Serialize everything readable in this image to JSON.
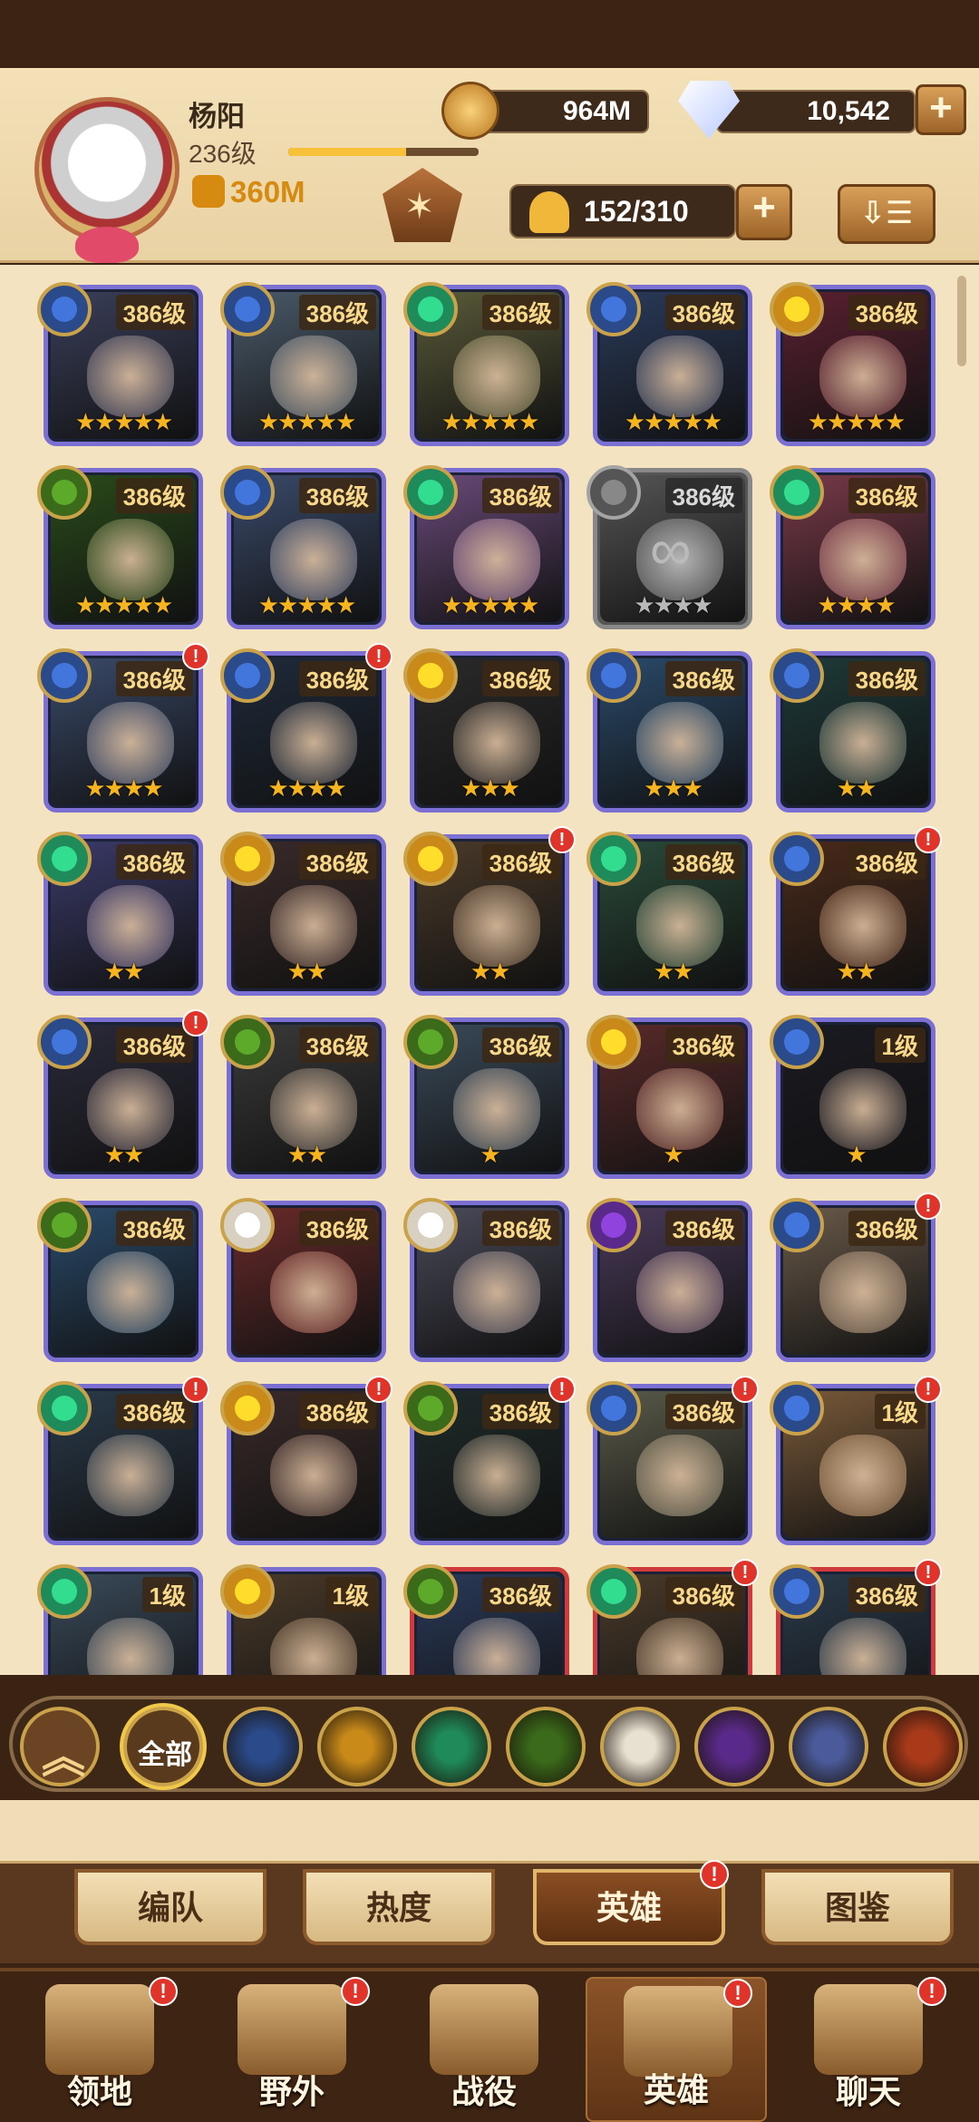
{
  "player": {
    "name": "杨阳",
    "level": "236级",
    "power": "360M",
    "xp_fraction": 0.62
  },
  "resources": {
    "gold": "964M",
    "gems": "10,542"
  },
  "hero_count": "152/310",
  "icons": {
    "gold": "gold-coin-icon",
    "gem": "diamond-icon",
    "plus": "+",
    "sort": "⇩☰",
    "emblem": "✶",
    "up": "︽"
  },
  "colors": {
    "purple_frame": "#7c6fd3",
    "red_frame": "#d13a3a",
    "alert": "#e0342a",
    "star": "#f6b51f"
  },
  "heroes": [
    {
      "level": "386级",
      "stars": "★★★★★",
      "faction": "#2a4a8a",
      "art": "#3a3f5a",
      "alert": false,
      "frame": "purple"
    },
    {
      "level": "386级",
      "stars": "★★★★★",
      "faction": "#2a4a8a",
      "art": "#4a5a6a",
      "alert": false,
      "frame": "purple"
    },
    {
      "level": "386级",
      "stars": "★★★★★",
      "faction": "#1f8a5a",
      "art": "#5a5a3a",
      "alert": false,
      "frame": "purple"
    },
    {
      "level": "386级",
      "stars": "★★★★★",
      "faction": "#2a4a8a",
      "art": "#2a3a5a",
      "alert": false,
      "frame": "purple"
    },
    {
      "level": "386级",
      "stars": "★★★★★",
      "faction": "#c98a1a",
      "art": "#5a2030",
      "alert": false,
      "frame": "purple"
    },
    {
      "level": "386级",
      "stars": "★★★★★",
      "faction": "#3a6a1a",
      "art": "#2a4a1a",
      "alert": false,
      "frame": "purple"
    },
    {
      "level": "386级",
      "stars": "★★★★★",
      "faction": "#2a4a8a",
      "art": "#3a4a6a",
      "alert": false,
      "frame": "purple"
    },
    {
      "level": "386级",
      "stars": "★★★★★",
      "faction": "#1f8a5a",
      "art": "#6a4a7a",
      "alert": false,
      "frame": "purple"
    },
    {
      "level": "386级",
      "stars": "★★★★",
      "faction": "#555555",
      "art": "#555555",
      "alert": false,
      "frame": "gray",
      "locked": true
    },
    {
      "level": "386级",
      "stars": "★★★★",
      "faction": "#1f8a5a",
      "art": "#7a3a4a",
      "alert": false,
      "frame": "purple"
    },
    {
      "level": "386级",
      "stars": "★★★★",
      "faction": "#2a4a8a",
      "art": "#3a4a6a",
      "alert": true,
      "frame": "purple"
    },
    {
      "level": "386级",
      "stars": "★★★★",
      "faction": "#2a4a8a",
      "art": "#1f2a3a",
      "alert": true,
      "frame": "purple"
    },
    {
      "level": "386级",
      "stars": "★★★",
      "faction": "#c98a1a",
      "art": "#2a2a2a",
      "alert": false,
      "frame": "purple"
    },
    {
      "level": "386级",
      "stars": "★★★",
      "faction": "#2a4a8a",
      "art": "#2a4a6a",
      "alert": false,
      "frame": "purple"
    },
    {
      "level": "386级",
      "stars": "★★",
      "faction": "#2a4a8a",
      "art": "#1f3a3a",
      "alert": false,
      "frame": "purple"
    },
    {
      "level": "386级",
      "stars": "★★",
      "faction": "#1f8a5a",
      "art": "#3a3a6a",
      "alert": false,
      "frame": "purple"
    },
    {
      "level": "386级",
      "stars": "★★",
      "faction": "#c98a1a",
      "art": "#3a2a2a",
      "alert": false,
      "frame": "purple"
    },
    {
      "level": "386级",
      "stars": "★★",
      "faction": "#c98a1a",
      "art": "#4a3a2a",
      "alert": true,
      "frame": "purple"
    },
    {
      "level": "386级",
      "stars": "★★",
      "faction": "#1f8a5a",
      "art": "#2a4a3a",
      "alert": false,
      "frame": "purple"
    },
    {
      "level": "386级",
      "stars": "★★",
      "faction": "#2a4a8a",
      "art": "#4a2a1a",
      "alert": true,
      "frame": "purple"
    },
    {
      "level": "386级",
      "stars": "★★",
      "faction": "#2a4a8a",
      "art": "#2a2a3a",
      "alert": true,
      "frame": "purple"
    },
    {
      "level": "386级",
      "stars": "★★",
      "faction": "#3a6a1a",
      "art": "#3a3a3a",
      "alert": false,
      "frame": "purple"
    },
    {
      "level": "386级",
      "stars": "★",
      "faction": "#3a6a1a",
      "art": "#3a4a5a",
      "alert": false,
      "frame": "purple"
    },
    {
      "level": "386级",
      "stars": "★",
      "faction": "#c98a1a",
      "art": "#5a2a2a",
      "alert": false,
      "frame": "purple"
    },
    {
      "level": "1级",
      "stars": "★",
      "faction": "#2a4a8a",
      "art": "#1a1a22",
      "alert": false,
      "frame": "purple"
    },
    {
      "level": "386级",
      "stars": "",
      "faction": "#3a6a1a",
      "art": "#2a4a6a",
      "alert": false,
      "frame": "purple"
    },
    {
      "level": "386级",
      "stars": "",
      "faction": "#d8d0c0",
      "art": "#6a2a2a",
      "alert": false,
      "frame": "purple"
    },
    {
      "level": "386级",
      "stars": "",
      "faction": "#d8d0c0",
      "art": "#4a4a5a",
      "alert": false,
      "frame": "purple"
    },
    {
      "level": "386级",
      "stars": "",
      "faction": "#5a2a8a",
      "art": "#4a3a5a",
      "alert": false,
      "frame": "purple"
    },
    {
      "level": "386级",
      "stars": "",
      "faction": "#2a4a8a",
      "art": "#6a5a4a",
      "alert": true,
      "frame": "purple"
    },
    {
      "level": "386级",
      "stars": "",
      "faction": "#1f8a5a",
      "art": "#2a3a4a",
      "alert": true,
      "frame": "purple"
    },
    {
      "level": "386级",
      "stars": "",
      "faction": "#c98a1a",
      "art": "#3a2a2a",
      "alert": true,
      "frame": "purple"
    },
    {
      "level": "386级",
      "stars": "",
      "faction": "#3a6a1a",
      "art": "#1f2a2a",
      "alert": true,
      "frame": "purple"
    },
    {
      "level": "386级",
      "stars": "",
      "faction": "#2a4a8a",
      "art": "#5a5a4a",
      "alert": true,
      "frame": "purple"
    },
    {
      "level": "1级",
      "stars": "",
      "faction": "#2a4a8a",
      "art": "#7a5a3a",
      "alert": true,
      "frame": "purple"
    },
    {
      "level": "1级",
      "stars": "",
      "faction": "#1f8a5a",
      "art": "#3a4a5a",
      "alert": false,
      "frame": "purple"
    },
    {
      "level": "1级",
      "stars": "",
      "faction": "#c98a1a",
      "art": "#4a3a2a",
      "alert": false,
      "frame": "purple"
    },
    {
      "level": "386级",
      "stars": "",
      "faction": "#3a6a1a",
      "art": "#2a3a5a",
      "alert": false,
      "frame": "red"
    },
    {
      "level": "386级",
      "stars": "",
      "faction": "#1f8a5a",
      "art": "#4a3a2a",
      "alert": true,
      "frame": "red"
    },
    {
      "level": "386级",
      "stars": "",
      "faction": "#2a4a8a",
      "art": "#2a3a4a",
      "alert": true,
      "frame": "red"
    }
  ],
  "filters": [
    {
      "name": "all",
      "label": "全部",
      "color": "#5a3a1d"
    },
    {
      "name": "lightbearer",
      "color": "#2a4a8a"
    },
    {
      "name": "mauler",
      "color": "#c98a1a"
    },
    {
      "name": "wilder",
      "color": "#1f8a5a"
    },
    {
      "name": "graveborn",
      "color": "#3a6a1a"
    },
    {
      "name": "celestial",
      "color": "#e8e0d0"
    },
    {
      "name": "hypogean",
      "color": "#5a2a8a"
    },
    {
      "name": "dimensional",
      "color": "#4a5a9a"
    },
    {
      "name": "draconis",
      "color": "#a83a1a"
    }
  ],
  "subtabs": [
    {
      "label": "编队",
      "active": false,
      "badge": false
    },
    {
      "label": "热度",
      "active": false,
      "badge": false
    },
    {
      "label": "英雄",
      "active": true,
      "badge": true
    },
    {
      "label": "图鉴",
      "active": false,
      "badge": false
    }
  ],
  "nav": [
    {
      "label": "领地",
      "badge": true,
      "active": false
    },
    {
      "label": "野外",
      "badge": true,
      "active": false
    },
    {
      "label": "战役",
      "badge": false,
      "active": false
    },
    {
      "label": "英雄",
      "badge": true,
      "active": true
    },
    {
      "label": "聊天",
      "badge": true,
      "active": false
    }
  ],
  "badge_text": "!"
}
